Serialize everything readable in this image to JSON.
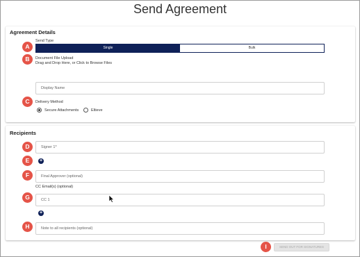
{
  "page_title": "Send Agreement",
  "agreement_details": {
    "title": "Agreement Details",
    "send_type": {
      "label": "Send Type",
      "options": [
        "Single",
        "Bulk"
      ],
      "selected": "Single"
    },
    "document_upload": {
      "label": "Document File Upload",
      "hint": "Drag and Drop Here, or Click to Browse Files"
    },
    "display_name": {
      "placeholder": "Display Name"
    },
    "delivery_method": {
      "label": "Delivery Method",
      "options": [
        "Secure Attachments",
        "Eltieve"
      ],
      "selected": "Secure Attachments"
    }
  },
  "recipients": {
    "title": "Recipients",
    "signer": {
      "placeholder": "Signer 1*"
    },
    "final_approver": {
      "placeholder": "Final Approver (optional)"
    },
    "cc_label": "CC Email(s) (optional)",
    "cc": {
      "placeholder": "CC 1"
    },
    "note": {
      "placeholder": "Note to all recipients (optional)"
    }
  },
  "submit_label": "SEND OUT FOR SIGNATURES",
  "markers": [
    "A",
    "B",
    "C",
    "D",
    "E",
    "F",
    "G",
    "H",
    "I"
  ],
  "colors": {
    "navy": "#0f2158",
    "marker": "#e55448"
  }
}
